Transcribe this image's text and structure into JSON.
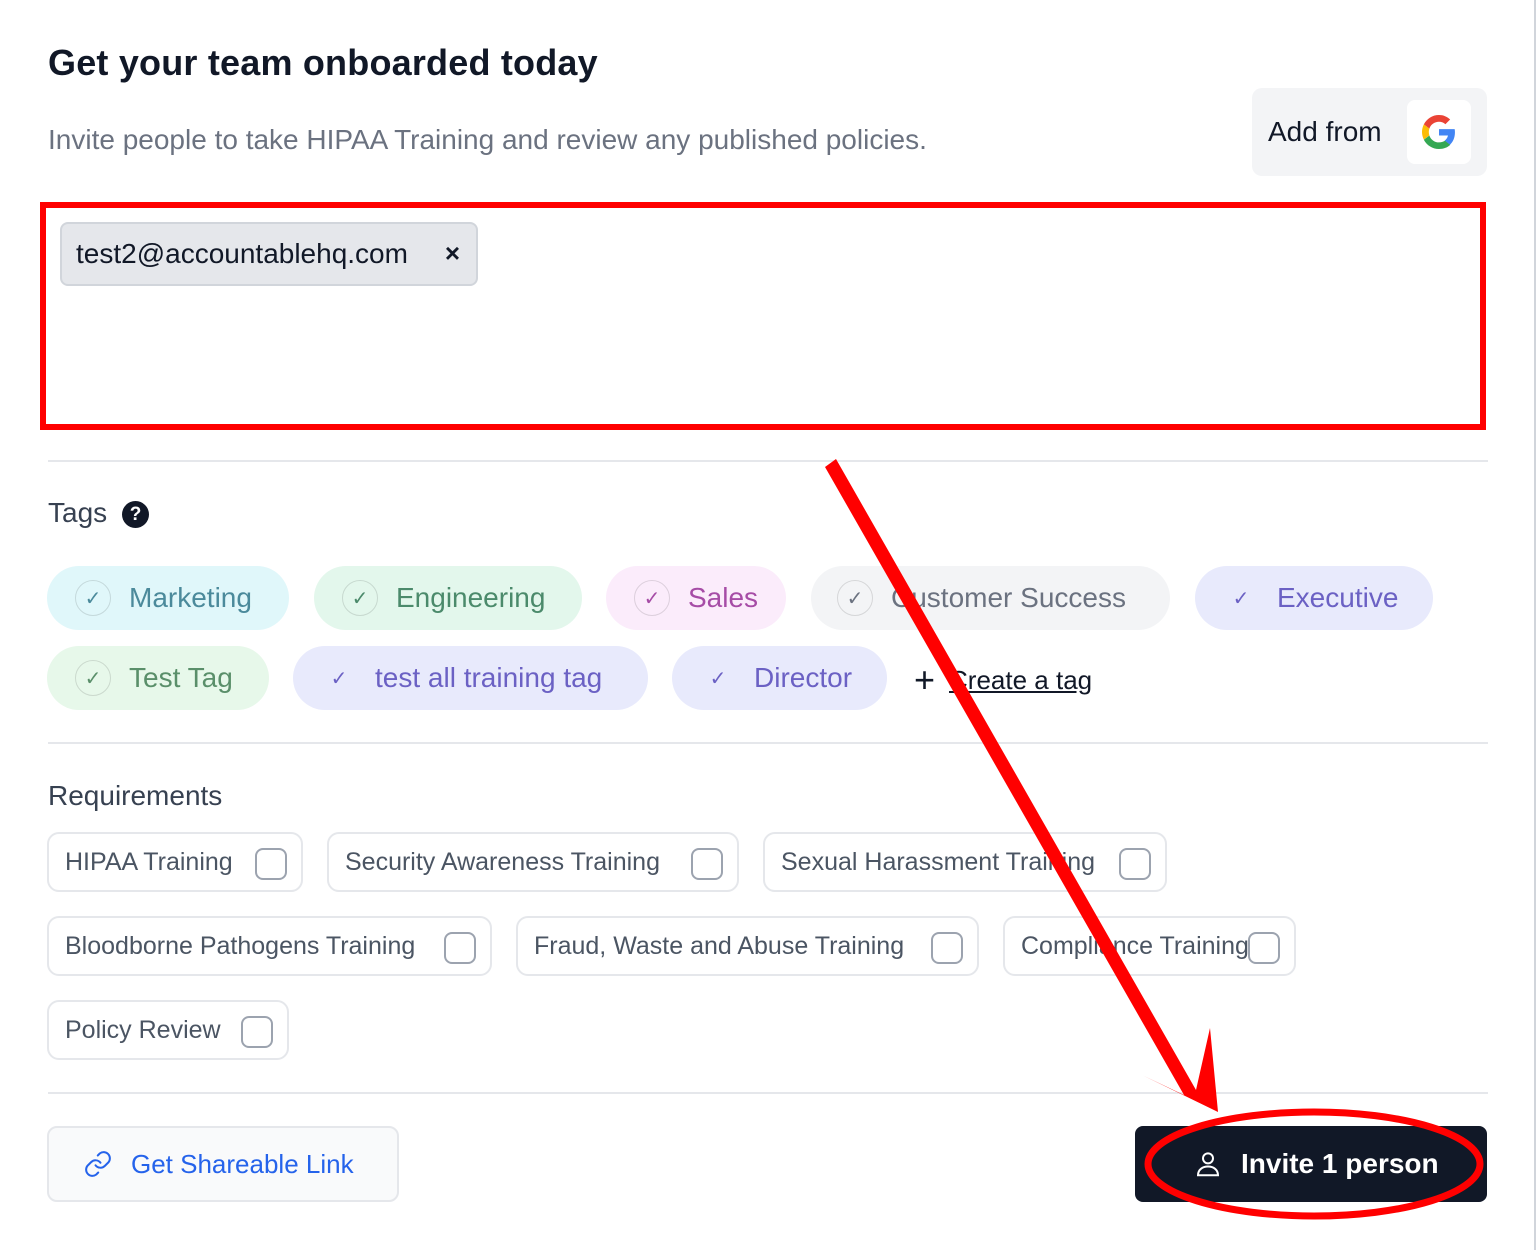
{
  "header": {
    "title": "Get your team onboarded today",
    "subtitle": "Invite people to take HIPAA Training and review any published policies.",
    "add_from_label": "Add from",
    "google_icon": "google-icon"
  },
  "invite_field": {
    "emails": [
      "test2@accountablehq.com"
    ],
    "remove_glyph": "×"
  },
  "tags_section": {
    "label": "Tags",
    "help_glyph": "?",
    "tags": [
      {
        "label": "Marketing",
        "bg": "#e0f7fa",
        "color": "#4b8a9b"
      },
      {
        "label": "Engineering",
        "bg": "#e3f7ec",
        "color": "#4b8a6b"
      },
      {
        "label": "Sales",
        "bg": "#fbecfb",
        "color": "#a64ca6"
      },
      {
        "label": "Customer Success",
        "bg": "#f3f4f6",
        "color": "#6b7280"
      },
      {
        "label": "Executive",
        "bg": "#e8eafc",
        "color": "#6b61c4"
      },
      {
        "label": "Test Tag",
        "bg": "#e7f8ea",
        "color": "#5a8f6a"
      },
      {
        "label": "test all training tag",
        "bg": "#e8eafc",
        "color": "#6b61c4"
      },
      {
        "label": "Director",
        "bg": "#e8eafc",
        "color": "#6b61c4"
      }
    ],
    "check_glyph": "✓",
    "create_label": "Create a tag"
  },
  "requirements_section": {
    "label": "Requirements",
    "items": [
      {
        "label": "HIPAA Training",
        "checked": false
      },
      {
        "label": "Security Awareness Training",
        "checked": false
      },
      {
        "label": "Sexual Harassment Training",
        "checked": false
      },
      {
        "label": "Bloodborne Pathogens Training",
        "checked": false
      },
      {
        "label": "Fraud, Waste and Abuse Training",
        "checked": false
      },
      {
        "label": "Compliance Training",
        "checked": false
      },
      {
        "label": "Policy Review",
        "checked": false
      }
    ]
  },
  "footer": {
    "share_label": "Get Shareable Link",
    "invite_label": "Invite 1 person"
  },
  "colors": {
    "annotation": "#ff0000",
    "primary_dark": "#111827",
    "link_blue": "#2563eb"
  }
}
